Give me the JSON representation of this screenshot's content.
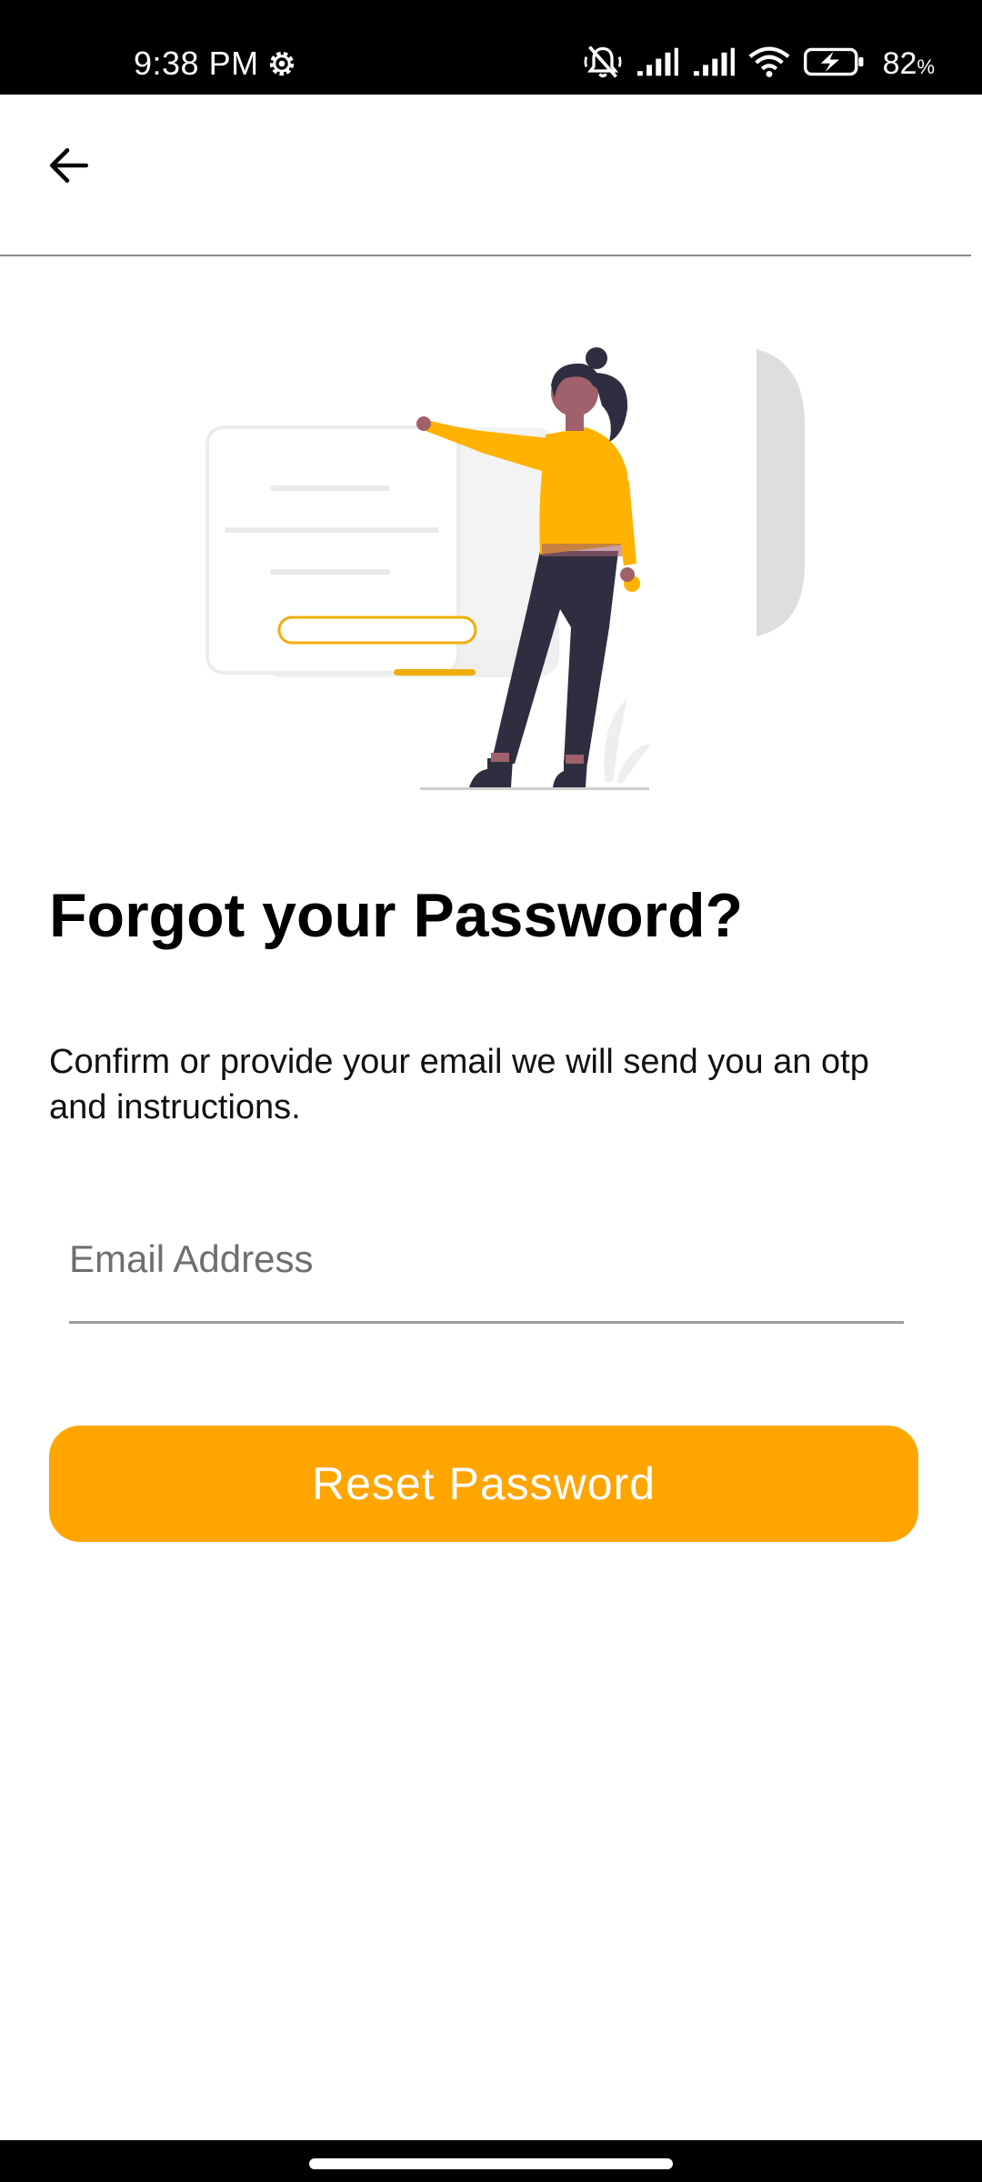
{
  "status_bar": {
    "time": "9:38 PM",
    "battery_percent": "82",
    "battery_unit": "%",
    "icons": [
      "settings-gear-icon",
      "mute-icon",
      "signal-icon",
      "signal-icon",
      "wifi-icon",
      "battery-charging-icon"
    ]
  },
  "app_bar": {
    "back_icon": "arrow-left-icon"
  },
  "content": {
    "title": "Forgot your Password?",
    "description": "Confirm or provide your email we will send you an otp and instructions.",
    "email_placeholder": "Email Address",
    "email_value": "",
    "reset_button_label": "Reset Password"
  },
  "colors": {
    "accent": "#FFA500",
    "status_bar_bg": "#000000",
    "illustration_dark": "#2F2E41",
    "illustration_gray": "#E0E0E0"
  }
}
